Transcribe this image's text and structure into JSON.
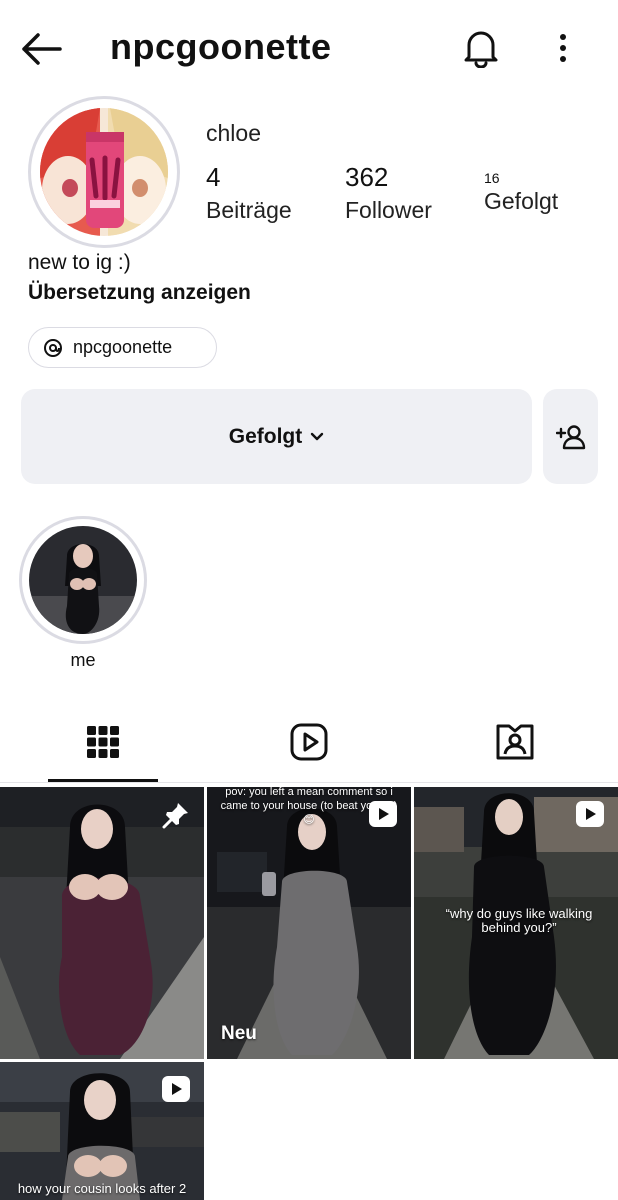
{
  "header": {
    "username": "npcgoonette",
    "back_icon": "arrow-left-icon",
    "bell_icon": "bell-icon",
    "more_icon": "more-vertical-icon"
  },
  "profile": {
    "display_name": "chloe",
    "stats": {
      "posts_count": "4",
      "posts_label": "Beiträge",
      "followers_count": "362",
      "followers_label": "Follower",
      "following_count": "16",
      "following_label": "Gefolgt"
    },
    "bio": "new to ig :)",
    "translate_label": "Übersetzung anzeigen",
    "threads_handle": "npcgoonette"
  },
  "actions": {
    "follow_label": "Gefolgt",
    "add_user_icon": "person-add-icon"
  },
  "highlights": [
    {
      "label": "me"
    }
  ],
  "tabs": [
    {
      "name": "grid",
      "icon": "grid-icon",
      "active": true
    },
    {
      "name": "reels",
      "icon": "reels-icon",
      "active": false
    },
    {
      "name": "tagged",
      "icon": "tagged-person-icon",
      "active": false
    }
  ],
  "posts": [
    {
      "type": "pinned",
      "badge_icon": "pin-icon",
      "caption": ""
    },
    {
      "type": "reel",
      "badge_icon": "play-icon",
      "caption": "pov: you left a mean comment so i came to your house (to beat you up) 😊",
      "label": "Neu"
    },
    {
      "type": "reel",
      "badge_icon": "play-icon",
      "caption": "“why do guys like walking behind you?”"
    },
    {
      "type": "reel",
      "badge_icon": "play-icon",
      "caption": "how your cousin looks after 2"
    }
  ],
  "colors": {
    "button_bg": "#eff0f4",
    "ring": "#dbdbe3",
    "text": "#111111"
  }
}
